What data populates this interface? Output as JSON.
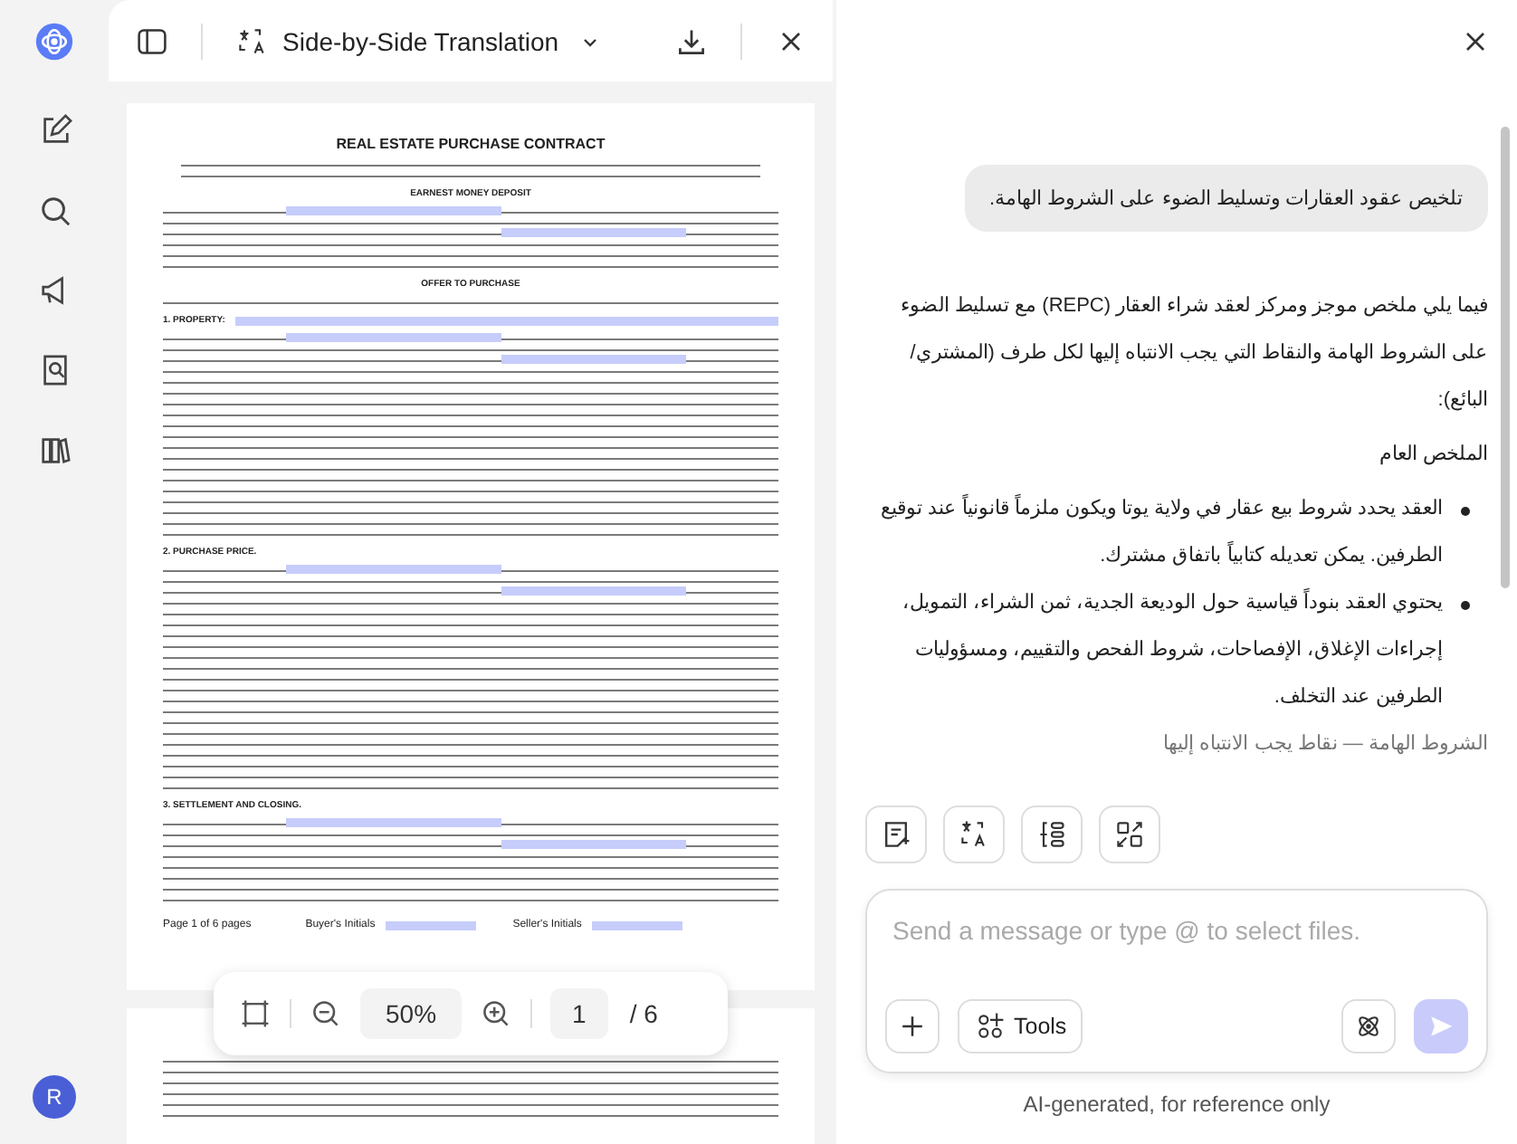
{
  "viewer": {
    "title": "Side-by-Side Translation"
  },
  "document": {
    "title": "REAL ESTATE PURCHASE CONTRACT",
    "sections": [
      {
        "heading": "EARNEST MONEY DEPOSIT",
        "kind": "center"
      },
      {
        "heading": "OFFER TO PURCHASE",
        "kind": "center"
      },
      {
        "heading": "1.    PROPERTY:",
        "kind": "field"
      },
      {
        "heading": "2.    PURCHASE PRICE.",
        "kind": "plain"
      },
      {
        "heading": "3.    SETTLEMENT AND CLOSING.",
        "kind": "plain"
      }
    ],
    "footer": {
      "page_label": "Page 1 of 6 pages",
      "buyer_initials": "Buyer's Initials",
      "seller_initials": "Seller's Initials"
    }
  },
  "zoom_bar": {
    "zoom": "50%",
    "page": "1",
    "total": "/ 6"
  },
  "sidebar": {
    "avatar": "R"
  },
  "chat": {
    "user_message": "تلخيص عقود العقارات وتسليط الضوء على الشروط الهامة.",
    "answer": [
      {
        "kind": "para",
        "text": "فيما يلي ملخص موجز ومركز لعقد شراء العقار (REPC) مع تسليط الضوء على الشروط الهامة والنقاط التي يجب الانتباه إليها لكل طرف (المشتري/البائع):"
      },
      {
        "kind": "para",
        "text": "الملخص العام"
      },
      {
        "kind": "bullet",
        "text": "العقد يحدد شروط بيع عقار في ولاية يوتا ويكون ملزماً قانونياً عند توقيع الطرفين. يمكن تعديله كتابياً باتفاق مشترك."
      },
      {
        "kind": "bullet",
        "text": "يحتوي العقد بنوداً قياسية حول الوديعة الجدية، ثمن الشراء، التمويل، إجراءات الإغلاق، الإفصاحات، شروط الفحص والتقييم، ومسؤوليات الطرفين عند التخلف."
      },
      {
        "kind": "faded",
        "text": "الشروط الهامة — نقاط يجب الانتباه إليها"
      }
    ],
    "input": {
      "placeholder": "Send a message or type @ to select files."
    },
    "tools_label": "Tools",
    "disclaimer": "AI-generated, for reference only"
  }
}
